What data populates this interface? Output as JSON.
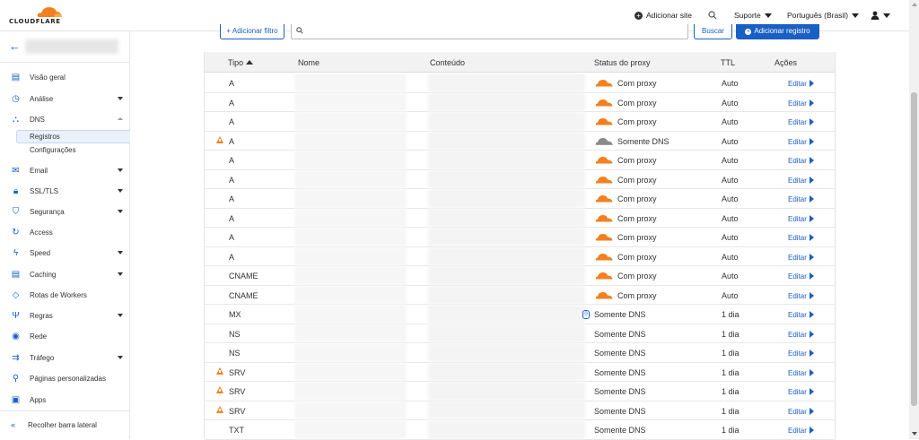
{
  "header": {
    "brand": "CLOUDFLARE",
    "add_site": "Adicionar site",
    "support": "Suporte",
    "language": "Português (Brasil)"
  },
  "sidebar": {
    "items": [
      {
        "label": "Visão geral",
        "icon": "overview-icon",
        "top": 0
      },
      {
        "label": "Análise",
        "icon": "analytics-icon",
        "chevron": "down"
      },
      {
        "label": "DNS",
        "icon": "dns-icon",
        "chevron": "up"
      },
      {
        "label": "Email",
        "icon": "email-icon",
        "chevron": "down"
      },
      {
        "label": "SSL/TLS",
        "icon": "lock-icon",
        "chevron": "down"
      },
      {
        "label": "Segurança",
        "icon": "shield-icon",
        "chevron": "down"
      },
      {
        "label": "Access",
        "icon": "access-icon"
      },
      {
        "label": "Speed",
        "icon": "speed-icon",
        "chevron": "down"
      },
      {
        "label": "Caching",
        "icon": "caching-icon",
        "chevron": "down"
      },
      {
        "label": "Rotas de Workers",
        "icon": "workers-icon"
      },
      {
        "label": "Regras",
        "icon": "rules-icon",
        "chevron": "down"
      },
      {
        "label": "Rede",
        "icon": "network-icon"
      },
      {
        "label": "Tráfego",
        "icon": "traffic-icon",
        "chevron": "down"
      },
      {
        "label": "Páginas personalizadas",
        "icon": "custom-pages-icon"
      },
      {
        "label": "Apps",
        "icon": "apps-icon"
      }
    ],
    "dns_sub": [
      "Registros",
      "Configurações"
    ],
    "collapse": "Recolher barra lateral"
  },
  "toolbar": {
    "filter_label": "+ Adicionar filtro",
    "search_label": "Buscar",
    "add_label": "Adicionar registro"
  },
  "table": {
    "headers": {
      "type": "Tipo",
      "name": "Nome",
      "content": "Conteúdo",
      "proxy": "Status do proxy",
      "ttl": "TTL",
      "actions": "Ações"
    },
    "edit_label": "Editar",
    "rows": [
      {
        "type": "A",
        "proxy": "Com proxy",
        "proxied": "orange",
        "ttl": "Auto",
        "warn": false
      },
      {
        "type": "A",
        "proxy": "Com proxy",
        "proxied": "orange",
        "ttl": "Auto",
        "warn": false
      },
      {
        "type": "A",
        "proxy": "Com proxy",
        "proxied": "orange",
        "ttl": "Auto",
        "warn": false
      },
      {
        "type": "A",
        "proxy": "Somente DNS",
        "proxied": "gray",
        "ttl": "Auto",
        "warn": true
      },
      {
        "type": "A",
        "proxy": "Com proxy",
        "proxied": "orange",
        "ttl": "Auto",
        "warn": false
      },
      {
        "type": "A",
        "proxy": "Com proxy",
        "proxied": "orange",
        "ttl": "Auto",
        "warn": false
      },
      {
        "type": "A",
        "proxy": "Com proxy",
        "proxied": "orange",
        "ttl": "Auto",
        "warn": false
      },
      {
        "type": "A",
        "proxy": "Com proxy",
        "proxied": "orange",
        "ttl": "Auto",
        "warn": false
      },
      {
        "type": "A",
        "proxy": "Com proxy",
        "proxied": "orange",
        "ttl": "Auto",
        "warn": false
      },
      {
        "type": "A",
        "proxy": "Com proxy",
        "proxied": "orange",
        "ttl": "Auto",
        "warn": false
      },
      {
        "type": "CNAME",
        "proxy": "Com proxy",
        "proxied": "orange",
        "ttl": "Auto",
        "warn": false
      },
      {
        "type": "CNAME",
        "proxy": "Com proxy",
        "proxied": "orange",
        "ttl": "Auto",
        "warn": false
      },
      {
        "type": "MX",
        "proxy": "Somente DNS",
        "proxied": "none",
        "ttl": "1 dia",
        "warn": false,
        "badge": "0"
      },
      {
        "type": "NS",
        "proxy": "Somente DNS",
        "proxied": "none",
        "ttl": "1 dia",
        "warn": false
      },
      {
        "type": "NS",
        "proxy": "Somente DNS",
        "proxied": "none",
        "ttl": "1 dia",
        "warn": false
      },
      {
        "type": "SRV",
        "proxy": "Somente DNS",
        "proxied": "none",
        "ttl": "1 dia",
        "warn": true
      },
      {
        "type": "SRV",
        "proxy": "Somente DNS",
        "proxied": "none",
        "ttl": "1 dia",
        "warn": true
      },
      {
        "type": "SRV",
        "proxy": "Somente DNS",
        "proxied": "none",
        "ttl": "1 dia",
        "warn": true
      },
      {
        "type": "TXT",
        "proxy": "Somente DNS",
        "proxied": "none",
        "ttl": "1 dia",
        "warn": false
      }
    ]
  },
  "colors": {
    "accent": "#1a5fc4",
    "brand_orange": "#f38020",
    "gray_cloud": "#8b8b8b"
  }
}
